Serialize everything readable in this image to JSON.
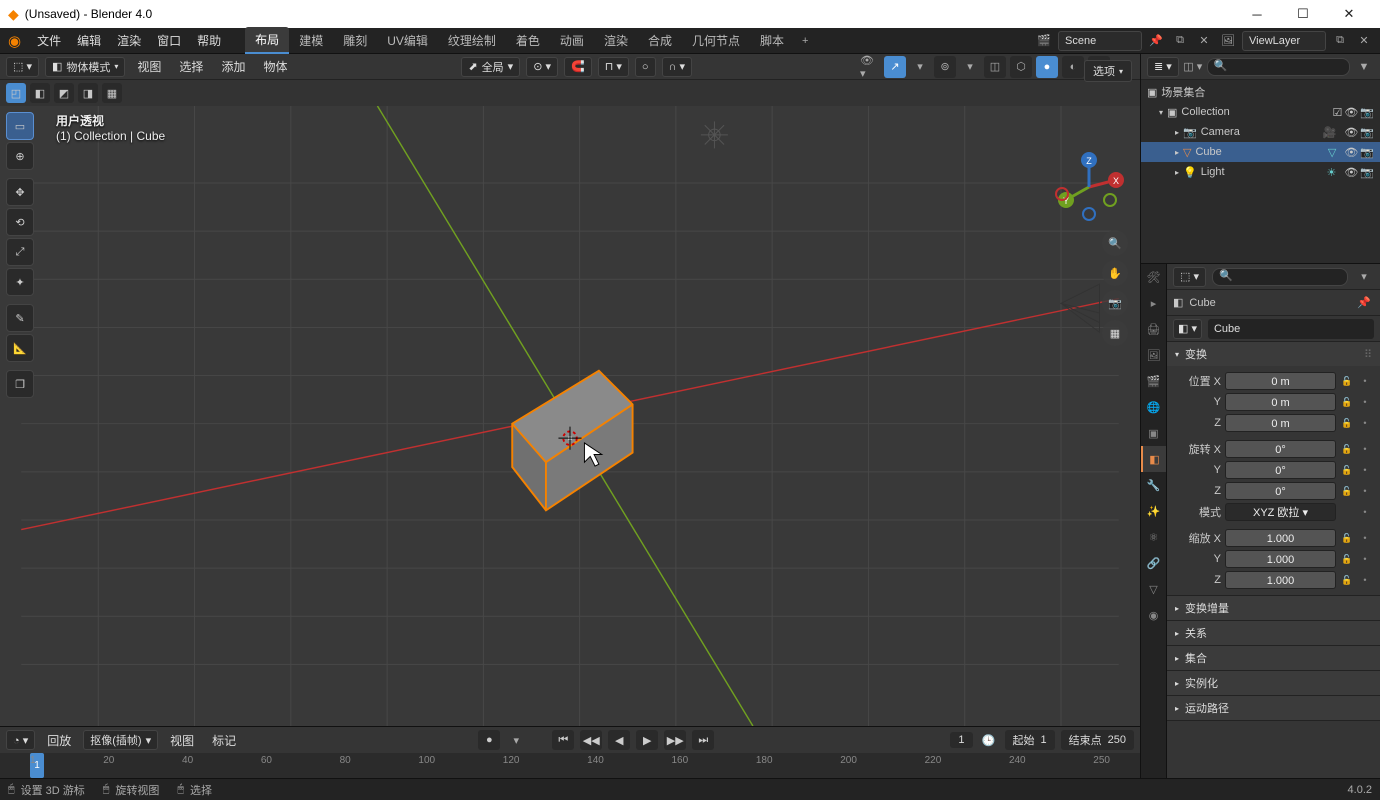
{
  "window": {
    "title": "(Unsaved) - Blender 4.0"
  },
  "menus": {
    "file": "文件",
    "edit": "编辑",
    "render": "渲染",
    "window": "窗口",
    "help": "帮助"
  },
  "workspaces": {
    "items": [
      "布局",
      "建模",
      "雕刻",
      "UV编辑",
      "纹理绘制",
      "着色",
      "动画",
      "渲染",
      "合成",
      "几何节点",
      "脚本"
    ],
    "active": 0
  },
  "scene": {
    "label": "Scene",
    "viewlayer": "ViewLayer"
  },
  "viewport": {
    "mode": "物体模式",
    "global": "全局",
    "menus": {
      "view": "视图",
      "select": "选择",
      "add": "添加",
      "object": "物体"
    },
    "overlay_title": "用户透视",
    "overlay_sub": "(1) Collection | Cube",
    "options": "选项"
  },
  "outliner": {
    "root": "场景集合",
    "collection": "Collection",
    "items": [
      {
        "name": "Camera",
        "icon": "camera"
      },
      {
        "name": "Cube",
        "icon": "mesh",
        "sel": true
      },
      {
        "name": "Light",
        "icon": "light"
      }
    ]
  },
  "properties": {
    "active_object": "Cube",
    "transform_title": "变换",
    "pos_label": "位置",
    "rot_label": "旋转",
    "scale_label": "缩放",
    "mode_label": "模式",
    "mode_value": "XYZ 欧拉",
    "axes": [
      "X",
      "Y",
      "Z"
    ],
    "position": [
      "0 m",
      "0 m",
      "0 m"
    ],
    "rotation": [
      "0°",
      "0°",
      "0°"
    ],
    "scale": [
      "1.000",
      "1.000",
      "1.000"
    ],
    "sections": [
      "变换增量",
      "关系",
      "集合",
      "实例化",
      "运动路径"
    ]
  },
  "timeline": {
    "playback": "回放",
    "keying": "抠像(插帧)",
    "view": "视图",
    "marker": "标记",
    "current": 1,
    "start_label": "起始",
    "start": 1,
    "end_label": "结束点",
    "end": 250,
    "ticks": [
      1,
      20,
      40,
      60,
      80,
      100,
      120,
      140,
      160,
      180,
      200,
      220,
      240,
      250
    ]
  },
  "status": {
    "left": "设置 3D 游标",
    "mid": "旋转视图",
    "right": "选择",
    "version": "4.0.2"
  }
}
